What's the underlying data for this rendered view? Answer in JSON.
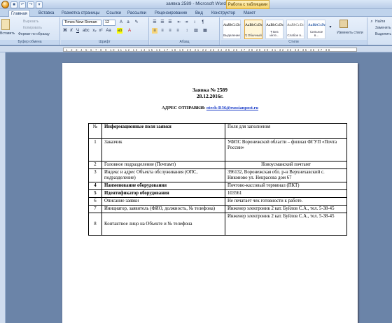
{
  "window": {
    "title": "заявка 2589 - Microsoft Word",
    "context_tab": "Работа с таблицами"
  },
  "tabs": [
    "Главная",
    "Вставка",
    "Разметка страницы",
    "Ссылки",
    "Рассылки",
    "Рецензирование",
    "Вид",
    "Конструктор",
    "Макет"
  ],
  "ribbon": {
    "clipboard": {
      "paste": "Вставить",
      "cut": "Вырезать",
      "copy": "Копировать",
      "format_painter": "Формат по образцу",
      "label": "Буфер обмена"
    },
    "font": {
      "name": "Times New Roman",
      "size": "12",
      "label": "Шрифт"
    },
    "paragraph": {
      "label": "Абзац"
    },
    "styles": {
      "items": [
        {
          "sample": "AaBbCcDc",
          "name": "Выделение"
        },
        {
          "sample": "AaBbCcDc",
          "name": "¶ Обычный"
        },
        {
          "sample": "AaBbCcDc",
          "name": "¶ Без инте..."
        },
        {
          "sample": "AaBbCcDc",
          "name": "Слабое в..."
        },
        {
          "sample": "AaBbCcDc",
          "name": "Сильное в..."
        }
      ],
      "change": "Изменить стили",
      "label": "Стили"
    },
    "editing": {
      "find": "Найти",
      "replace": "Заменить",
      "select": "Выделить"
    }
  },
  "document": {
    "title": "Заявка № 2589",
    "date": "28.12.2016г.",
    "address_label": "АДРЕС ОТПРАВКИ:",
    "address_email": "otech-R36@russianpost.ru",
    "table": {
      "headers": [
        "№",
        "Информационные поля заявки",
        "Поля для заполнения"
      ],
      "rows": [
        [
          "1",
          "Заказчик",
          "УФПС Воронежской области – филиал ФГУП «Почта России»"
        ],
        [
          "2",
          "Головное подразделение (Почтамт)",
          "Новоусманский почтамт"
        ],
        [
          "3",
          "Индекс и адрес Объекта обслуживания (ОПС, подразделение)",
          "396132, Воронежская обл. р-н Верхнехавский с. Никоново ул. Некрасова дом 67"
        ],
        [
          "4",
          "Наименование оборудования",
          "Почтово-кассовый терминал (ПКТ)"
        ],
        [
          "5",
          "Идентификатор оборудования",
          "103561"
        ],
        [
          "6",
          "Описание заявки",
          "Не печатает чек готовности к работе."
        ],
        [
          "7",
          "Инициатор, заявитель (ФИО, должность, № телефона)",
          "Инженер электроник 2 кат. Буйлов С.А., тел. 5-38-45"
        ],
        [
          "8",
          "Контактное лицо на Объекте и № телефона",
          "Инженер электроник 2 кат. Буйлов С.А., тел. 5-38-45"
        ]
      ]
    }
  }
}
